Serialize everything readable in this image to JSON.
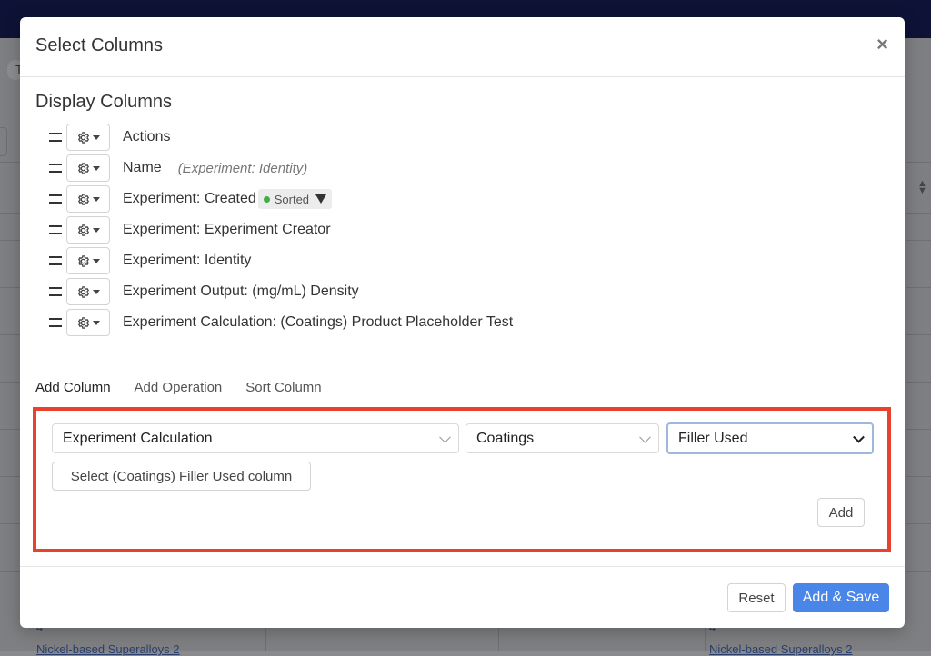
{
  "background": {
    "tab_letter": "T",
    "num_left": "4",
    "num_right": "4",
    "link_left": "Nickel-based Superalloys 2",
    "link_right": "Nickel-based Superalloys 2"
  },
  "modal": {
    "title": "Select Columns",
    "close_label": "×",
    "display_columns_title": "Display Columns",
    "columns": [
      {
        "label": "Actions",
        "sub": ""
      },
      {
        "label": "Name",
        "sub": "(Experiment: Identity)"
      },
      {
        "label": "Experiment: Created",
        "sub": "",
        "badge": "Sorted"
      },
      {
        "label": "Experiment: Experiment Creator",
        "sub": ""
      },
      {
        "label": "Experiment: Identity",
        "sub": ""
      },
      {
        "label": "Experiment Output: (mg/mL) Density",
        "sub": ""
      },
      {
        "label": "Experiment Calculation: (Coatings) Product Placeholder Test",
        "sub": ""
      }
    ],
    "tabs": [
      "Add Column",
      "Add Operation",
      "Sort Column"
    ],
    "add_column": {
      "source_select": "Experiment Calculation",
      "category_select": "Coatings",
      "field_select": "Filler Used",
      "select_button": "Select (Coatings) Filler Used column",
      "add_button": "Add"
    },
    "footer": {
      "reset_button": "Reset",
      "add_save_button": "Add & Save"
    }
  },
  "colors": {
    "highlight": "#e8412e",
    "primary": "#4a86e8",
    "sorted_dot": "#3cb043"
  }
}
